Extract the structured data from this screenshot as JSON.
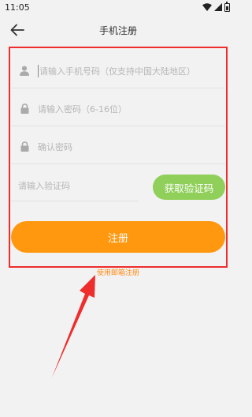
{
  "status_bar": {
    "time": "11:05",
    "icons": [
      "wifi-icon",
      "signal-icon",
      "battery-icon"
    ]
  },
  "header": {
    "title": "手机注册",
    "back_icon": "arrow-left-icon"
  },
  "form": {
    "phone": {
      "placeholder": "请输入手机号码（仅支持中国大陆地区）",
      "icon": "user-icon"
    },
    "password": {
      "placeholder": "请输入密码（6-16位）",
      "icon": "lock-icon"
    },
    "confirm_password": {
      "placeholder": "确认密码",
      "icon": "lock-icon"
    },
    "verification_code": {
      "placeholder": "请输入验证码"
    },
    "get_code_label": "获取验证码",
    "register_label": "注册",
    "email_register_link": "使用邮箱注册"
  },
  "colors": {
    "background": "#f2f2f2",
    "accent_orange": "#ff980f",
    "get_code_green": "#8fcf5a",
    "highlight_red": "#ee2d2d",
    "link_orange": "#ff8a16"
  }
}
